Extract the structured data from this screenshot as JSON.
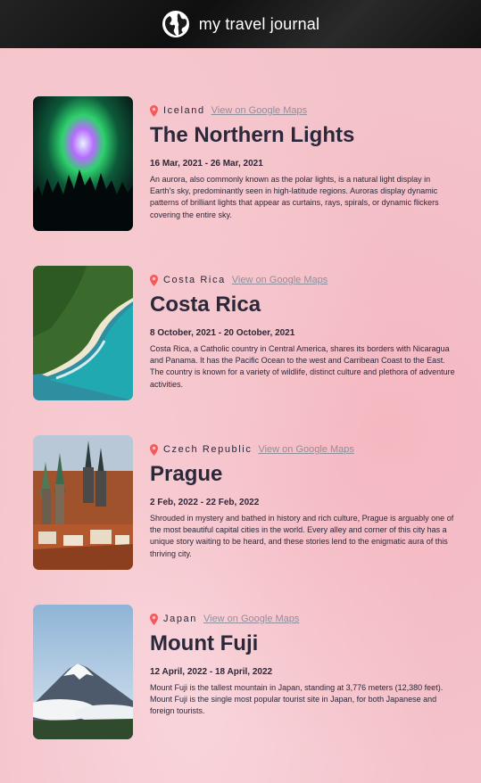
{
  "header": {
    "title": "my travel journal",
    "icon": "globe-icon"
  },
  "entries": [
    {
      "country": "Iceland",
      "maps_link": "View on Google Maps",
      "place": "The Northern Lights",
      "dates": "16 Mar, 2021 - 26 Mar, 2021",
      "description": "An aurora, also commonly known as the polar lights, is a natural light display in Earth's sky, predominantly seen in high-latitude regions. Auroras display dynamic patterns of brilliant lights that appear as curtains, rays, spirals, or dynamic flickers covering the entire sky."
    },
    {
      "country": "Costa Rica",
      "maps_link": "View on Google Maps",
      "place": "Costa Rica",
      "dates": "8 October, 2021 - 20 October, 2021",
      "description": "Costa Rica, a Catholic country in Central America, shares its borders with Nicaragua and Panama. It has the Pacific Ocean to the west and Carribean Coast to the East. The country is known for a variety of wildlife, distinct culture and plethora of adventure activities."
    },
    {
      "country": "Czech Republic",
      "maps_link": "View on Google Maps",
      "place": "Prague",
      "dates": "2 Feb, 2022 - 22 Feb, 2022",
      "description": "Shrouded in mystery and bathed in history and rich culture, Prague is arguably one of the most beautiful capital cities in the world. Every alley and corner of this city has a unique story waiting to be heard, and these stories lend to the enigmatic aura of this thriving city."
    },
    {
      "country": "Japan",
      "maps_link": "View on Google Maps",
      "place": "Mount Fuji",
      "dates": "12 April, 2022 - 18 April, 2022",
      "description": "Mount Fuji is the tallest mountain in Japan, standing at 3,776 meters (12,380 feet). Mount Fuji is the single most popular tourist site in Japan, for both Japanese and foreign tourists."
    }
  ],
  "colors": {
    "accent_pin": "#f55a5a",
    "link": "#918e9b",
    "text": "#2b283a"
  }
}
